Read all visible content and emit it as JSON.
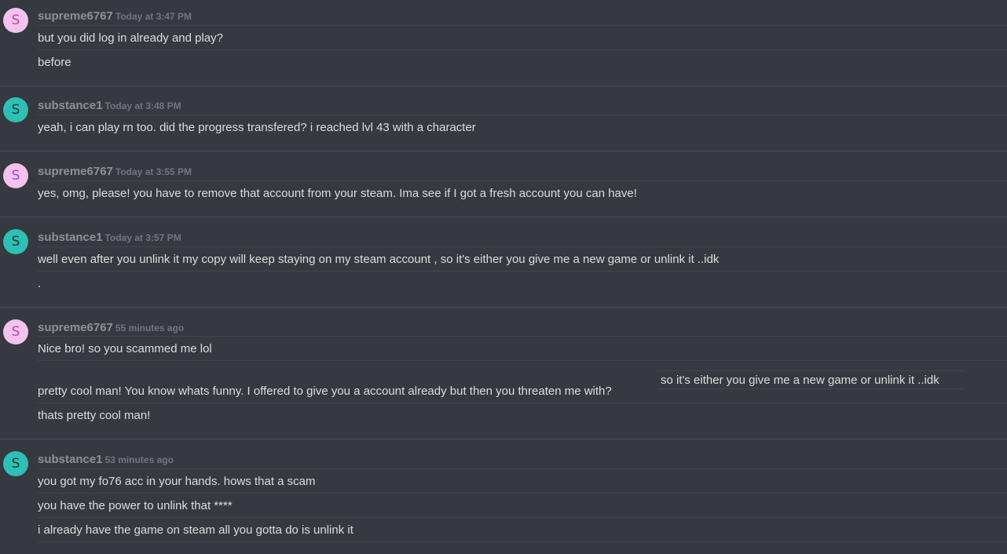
{
  "groups": [
    {
      "username": "supreme6767",
      "timestamp": "Today at 3:47 PM",
      "avatar_letter": "S",
      "messages": [
        "but you did log in already and play?",
        "before"
      ]
    },
    {
      "username": "substance1",
      "timestamp": "Today at 3:48 PM",
      "avatar_letter": "S",
      "messages": [
        "yeah, i can play rn too. did the progress transfered? i reached lvl 43 with a character"
      ]
    },
    {
      "username": "supreme6767",
      "timestamp": "Today at 3:55 PM",
      "avatar_letter": "S",
      "messages": [
        "yes, omg, please! you have to remove that account from your steam. Ima see if I got a fresh account you can have!"
      ]
    },
    {
      "username": "substance1",
      "timestamp": "Today at 3:57 PM",
      "avatar_letter": "S",
      "messages": [
        "well even after you unlink it my copy will keep staying on my steam account , so it's either you give me a new game or unlink it ..idk",
        "."
      ]
    },
    {
      "username": "supreme6767",
      "timestamp": "55 minutes ago",
      "avatar_letter": "S",
      "messages": [
        "Nice bro! so you scammed me lol",
        "pretty cool man! You know whats funny. I offered to give you a account already but then you threaten me with?",
        "thats pretty cool man!"
      ],
      "quote": "so it's either you give me a new game or unlink it ..idk"
    },
    {
      "username": "substance1",
      "timestamp": "53 minutes ago",
      "avatar_letter": "S",
      "messages": [
        "you got my fo76 acc in your hands. hows that a scam",
        "you have the power to unlink that ****",
        "i already have the game on steam all you gotta do is unlink it"
      ]
    }
  ],
  "colors": {
    "background": "#36393f",
    "username": "#8e9297",
    "timestamp": "#72767d",
    "message_text": "#dcddde",
    "avatar_supreme6767_bg": "#f4c2ef",
    "avatar_substance1_bg": "#2fbfb5"
  }
}
